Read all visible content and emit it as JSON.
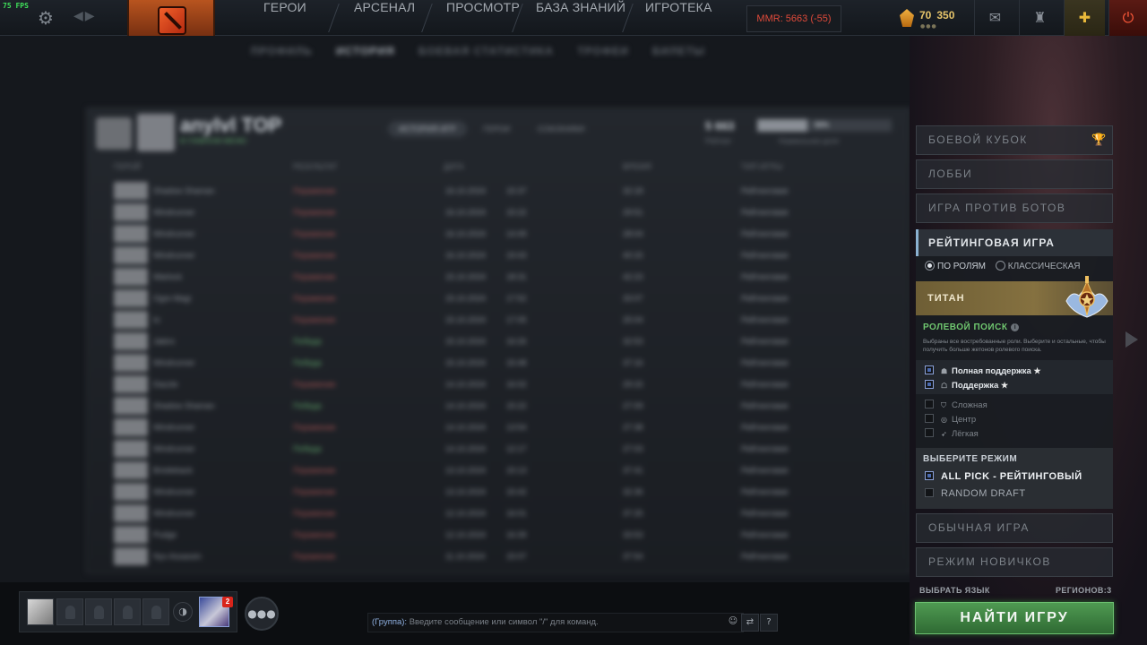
{
  "topbar": {
    "fps": "75 FPS",
    "menu": [
      "ГЕРОИ",
      "АРСЕНАЛ",
      "ПРОСМОТР",
      "БАЗА ЗНАНИЙ",
      "ИГРОТЕКА"
    ],
    "mmr": "MMR: 5663 (-55)",
    "currency_1": "70",
    "currency_2": "350",
    "icons": [
      "gear-icon",
      "dota-logo-icon",
      "mail-icon",
      "armory-icon",
      "plus-icon",
      "power-icon"
    ]
  },
  "profile": {
    "subnav": [
      "ПРОФИЛЬ",
      "ИСТОРИЯ",
      "БОЕВАЯ СТАТИСТИКА",
      "ТРОФЕИ",
      "БИЛЕТЫ"
    ],
    "player_name": "anylvl TOP",
    "player_status": "В ГЛАВНОМ МЕНЮ",
    "tabs": [
      "ИСТОРИЯ ИГР",
      "ГЕРОИ",
      "СОЮЗНИКИ"
    ],
    "stat_value": "5 663",
    "stat_label": "Рейтинг",
    "bar_value": "50%",
    "bar_label": "Нормальная доля",
    "columns": [
      "ГЕРОЙ",
      "РЕЗУЛЬТАТ",
      "ДАТА",
      "ВРЕМЯ",
      "ТИП ИГРЫ"
    ],
    "rows": [
      {
        "hero": "Shadow Shaman",
        "result": "Поражение",
        "date": "16.10.2024",
        "time": "15:37",
        "duration": "32:18",
        "type": "Рейтинговая"
      },
      {
        "hero": "Windrunner",
        "result": "Поражение",
        "date": "16.10.2024",
        "time": "15:22",
        "duration": "29:51",
        "type": "Рейтинговая"
      },
      {
        "hero": "Windrunner",
        "result": "Поражение",
        "date": "16.10.2024",
        "time": "14:49",
        "duration": "28:04",
        "type": "Рейтинговая"
      },
      {
        "hero": "Windrunner",
        "result": "Поражение",
        "date": "16.10.2024",
        "time": "19:43",
        "duration": "40:15",
        "type": "Рейтинговая"
      },
      {
        "hero": "Warlock",
        "result": "Поражение",
        "date": "15.10.2024",
        "time": "18:31",
        "duration": "42:23",
        "type": "Рейтинговая"
      },
      {
        "hero": "Ogre Magi",
        "result": "Поражение",
        "date": "15.10.2024",
        "time": "17:52",
        "duration": "33:07",
        "type": "Рейтинговая"
      },
      {
        "hero": "Io",
        "result": "Поражение",
        "date": "15.10.2024",
        "time": "17:05",
        "duration": "25:04",
        "type": "Рейтинговая"
      },
      {
        "hero": "Jakiro",
        "result": "Победа",
        "date": "15.10.2024",
        "time": "16:26",
        "duration": "32:53",
        "type": "Рейтинговая"
      },
      {
        "hero": "Windrunner",
        "result": "Победа",
        "date": "15.10.2024",
        "time": "15:48",
        "duration": "37:16",
        "type": "Рейтинговая"
      },
      {
        "hero": "Dazzle",
        "result": "Поражение",
        "date": "14.10.2024",
        "time": "16:02",
        "duration": "29:15",
        "type": "Рейтинговая"
      },
      {
        "hero": "Shadow Shaman",
        "result": "Победа",
        "date": "14.10.2024",
        "time": "15:22",
        "duration": "27:09",
        "type": "Рейтинговая"
      },
      {
        "hero": "Windrunner",
        "result": "Поражение",
        "date": "14.10.2024",
        "time": "13:54",
        "duration": "27:38",
        "type": "Рейтинговая"
      },
      {
        "hero": "Windrunner",
        "result": "Победа",
        "date": "14.10.2024",
        "time": "12:17",
        "duration": "27:03",
        "type": "Рейтинговая"
      },
      {
        "hero": "Bristleback",
        "result": "Поражение",
        "date": "13.10.2024",
        "time": "15:13",
        "duration": "37:41",
        "type": "Рейтинговая"
      },
      {
        "hero": "Windrunner",
        "result": "Поражение",
        "date": "13.10.2024",
        "time": "15:42",
        "duration": "32:36",
        "type": "Рейтинговая"
      },
      {
        "hero": "Windrunner",
        "result": "Поражение",
        "date": "12.10.2024",
        "time": "16:01",
        "duration": "37:25",
        "type": "Рейтинговая"
      },
      {
        "hero": "Pudge",
        "result": "Поражение",
        "date": "12.10.2024",
        "time": "16:39",
        "duration": "33:53",
        "type": "Рейтинговая"
      },
      {
        "hero": "Nyx Assassin",
        "result": "Поражение",
        "date": "11.10.2024",
        "time": "15:07",
        "duration": "37:54",
        "type": "Рейтинговая"
      }
    ]
  },
  "play_panel": {
    "battle_cup": "БОЕВОЙ КУБОК",
    "lobby": "ЛОББИ",
    "vs_bots": "ИГРА ПРОТИВ БОТОВ",
    "ranked_title": "РЕЙТИНГОВАЯ ИГРА",
    "by_roles": "ПО РОЛЯМ",
    "classic": "КЛАССИЧЕСКАЯ",
    "rank": "ТИТАН",
    "role_search": "РОЛЕВОЙ ПОИСК",
    "role_desc": "Выбраны все востребованные роли. Выберите и остальные, чтобы получить больше жетонов ролевого поиска.",
    "roles": [
      {
        "label": "Полная поддержка",
        "selected": true,
        "starred": true,
        "icon": "hard-support-icon"
      },
      {
        "label": "Поддержка",
        "selected": true,
        "starred": true,
        "icon": "support-icon"
      },
      {
        "label": "Сложная",
        "selected": false,
        "starred": false,
        "icon": "offlane-icon"
      },
      {
        "label": "Центр",
        "selected": false,
        "starred": false,
        "icon": "mid-icon"
      },
      {
        "label": "Лёгкая",
        "selected": false,
        "starred": false,
        "icon": "safelane-icon"
      }
    ],
    "star_glyph": "★",
    "choose_mode": "ВЫБЕРИТЕ РЕЖИМ",
    "mode_all_pick": "ALL PICK - РЕЙТИНГОВЫЙ",
    "mode_random_draft": "RANDOM DRAFT",
    "normal_game": "ОБЫЧНАЯ ИГРА",
    "novice_mode": "РЕЖИМ НОВИЧКОВ",
    "choose_language": "ВЫБРАТЬ ЯЗЫК",
    "regions": "РЕГИОНОВ:3",
    "find_match": "НАЙТИ ИГРУ"
  },
  "bottom": {
    "notification_count": "2",
    "chat_channel": "(Группа):",
    "chat_placeholder": "Введите сообщение или символ \"/\" для команд.",
    "help": "?"
  },
  "colors": {
    "mmr_red": "#e04a3a",
    "win_green": "#5fa56a",
    "find_green": "#4f9a52",
    "titan_gold": "#857140",
    "role_search_green": "#6fc66f"
  }
}
